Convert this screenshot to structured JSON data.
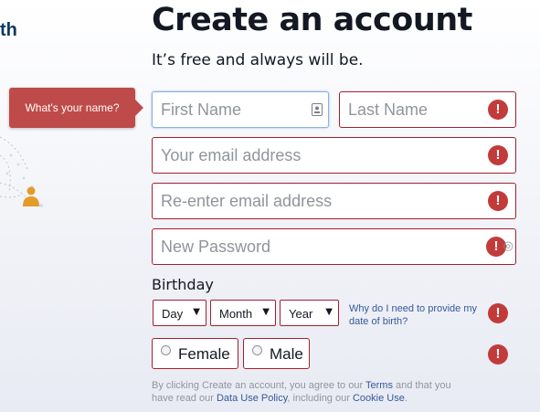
{
  "left_panel": {
    "tagline_fragment": "th"
  },
  "header": {
    "title": "Create an account",
    "subtitle": "It’s free and always will be."
  },
  "tooltip": {
    "text": "What's your name?"
  },
  "form": {
    "first_name": {
      "placeholder": "First Name",
      "value": ""
    },
    "last_name": {
      "placeholder": "Last Name",
      "value": ""
    },
    "email": {
      "placeholder": "Your email address",
      "value": ""
    },
    "email_confirm": {
      "placeholder": "Re-enter email address",
      "value": ""
    },
    "password": {
      "placeholder": "New Password",
      "value": ""
    },
    "birthday": {
      "label": "Birthday",
      "day": "Day",
      "month": "Month",
      "year": "Year",
      "why_link": "Why do I need to provide my date of birth?"
    },
    "gender": {
      "female": "Female",
      "male": "Male"
    },
    "error_glyph": "!"
  },
  "terms": {
    "prefix": "By clicking Create an account, you agree to our",
    "terms_link": "Terms",
    "middle": "and that you have read our",
    "data_policy_link": "Data Use Policy",
    "suffix": ", including our",
    "cookie_link": "Cookie Use",
    "end": "."
  },
  "colors": {
    "error_border": "#a3202e",
    "error_icon": "#c23b3b",
    "tooltip_bg": "#be4b49",
    "focus_border": "#8db2e3",
    "link": "#365899",
    "title": "#141823"
  }
}
